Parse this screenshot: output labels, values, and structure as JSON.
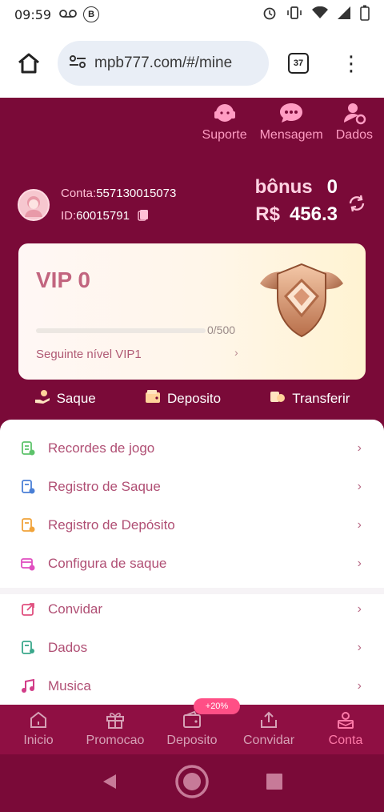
{
  "status_bar": {
    "time": "09:59",
    "b_badge": "B"
  },
  "browser": {
    "url": "mpb777.com/#/mine",
    "tab_count": "37"
  },
  "header": {
    "icons": [
      {
        "label": "Suporte",
        "icon": "headset-icon"
      },
      {
        "label": "Mensagem",
        "icon": "chat-icon"
      },
      {
        "label": "Dados",
        "icon": "user-settings-icon"
      }
    ]
  },
  "account": {
    "conta_label": "Conta:",
    "conta_value": "557130015073",
    "id_label": "ID:",
    "id_value": "60015791",
    "bonus_label": "bônus",
    "bonus_value": "0",
    "currency": "R$",
    "balance": "456.3"
  },
  "vip": {
    "level": "VIP 0",
    "progress_text": "0/500",
    "progress_fraction": 0,
    "next_label": "Seguinte nível VIP1",
    "arrow": "›"
  },
  "actions": [
    {
      "label": "Saque",
      "icon": "hand-coin-icon"
    },
    {
      "label": "Deposito",
      "icon": "wallet-icon"
    },
    {
      "label": "Transferir",
      "icon": "transfer-icon"
    }
  ],
  "menu": [
    {
      "label": "Recordes de jogo",
      "icon": "records-icon",
      "color": "#5dc36b"
    },
    {
      "label": "Registro de Saque",
      "icon": "withdraw-log-icon",
      "color": "#4a7fd6"
    },
    {
      "label": "Registro de Depósito",
      "icon": "deposit-log-icon",
      "color": "#f1a33a"
    },
    {
      "label": "Configura de saque",
      "icon": "withdraw-config-icon",
      "color": "#e04fc0"
    },
    {
      "label": "Convidar",
      "icon": "invite-icon",
      "color": "#e0507f"
    },
    {
      "label": "Dados",
      "icon": "data-icon",
      "color": "#3aa78b"
    },
    {
      "label": "Musica",
      "icon": "music-icon",
      "color": "#d13d88"
    }
  ],
  "bottom_nav": [
    {
      "label": "Inicio",
      "icon": "home-icon"
    },
    {
      "label": "Promocao",
      "icon": "gift-icon"
    },
    {
      "label": "Deposito",
      "icon": "wallet-icon"
    },
    {
      "label": "Convidar",
      "icon": "share-icon"
    },
    {
      "label": "Conta",
      "icon": "account-icon"
    }
  ],
  "deposit_bonus_badge": "+20%",
  "colors": {
    "brand": "#7a0a38",
    "nav_bg": "#8f0f43",
    "accent_pink": "#ff7aa8"
  }
}
